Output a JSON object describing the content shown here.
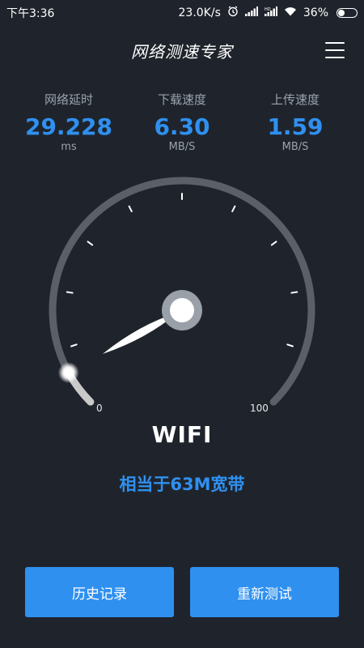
{
  "status_bar": {
    "time": "下午3:36",
    "net_speed": "23.0K/s",
    "battery_percent": "36%",
    "battery_level": 0.36,
    "icons": [
      "alarm-icon",
      "signal-icon",
      "hd-signal-icon",
      "wifi-icon",
      "battery-icon"
    ]
  },
  "header": {
    "title": "网络测速专家",
    "menu_icon": "hamburger-menu-icon"
  },
  "metrics": {
    "latency": {
      "label": "网络延时",
      "value": "29.228",
      "unit": "ms"
    },
    "download": {
      "label": "下载速度",
      "value": "6.30",
      "unit": "MB/S"
    },
    "upload": {
      "label": "上传速度",
      "value": "1.59",
      "unit": "MB/S"
    }
  },
  "gauge": {
    "min_label": "0",
    "max_label": "100",
    "progress_fraction": 0.06,
    "colors": {
      "track": "#5b6068",
      "progress": "#c9c9c9",
      "needle": "#ffffff",
      "hub_ring": "#9aa0a8"
    }
  },
  "connection": {
    "type": "WIFI",
    "equivalent": "相当于63M宽带"
  },
  "buttons": {
    "history": "历史记录",
    "retest": "重新测试"
  },
  "colors": {
    "accent": "#2f90f0",
    "background": "#1f242c",
    "muted_text": "#9aa2ad"
  }
}
